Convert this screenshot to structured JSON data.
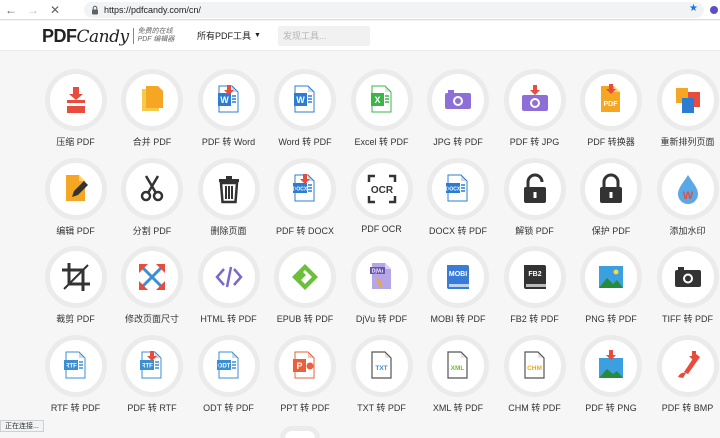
{
  "browser": {
    "url": "https://pdfcandy.com/cn/",
    "status_text": "正在连接..."
  },
  "header": {
    "logo_main": "PDF",
    "logo_script": "Candy",
    "logo_tag_line1": "免费的在线",
    "logo_tag_line2": "PDF 编辑器",
    "menu_label": "所有PDF工具",
    "search_placeholder": "发现工具..."
  },
  "tools": [
    {
      "label": "压缩 PDF",
      "icon": "compress-icon"
    },
    {
      "label": "合并 PDF",
      "icon": "merge-icon"
    },
    {
      "label": "PDF 转 Word",
      "icon": "pdf-to-word-icon"
    },
    {
      "label": "Word 转 PDF",
      "icon": "word-to-pdf-icon"
    },
    {
      "label": "Excel 转 PDF",
      "icon": "excel-to-pdf-icon"
    },
    {
      "label": "JPG 转 PDF",
      "icon": "jpg-to-pdf-icon"
    },
    {
      "label": "PDF 转 JPG",
      "icon": "pdf-to-jpg-icon"
    },
    {
      "label": "PDF 转换器",
      "icon": "pdf-converter-icon"
    },
    {
      "label": "重新排列页面",
      "icon": "rearrange-icon"
    },
    {
      "label": "编辑 PDF",
      "icon": "edit-pdf-icon"
    },
    {
      "label": "分割 PDF",
      "icon": "scissors-icon"
    },
    {
      "label": "删除页面",
      "icon": "trash-icon"
    },
    {
      "label": "PDF 转 DOCX",
      "icon": "pdf-to-docx-icon"
    },
    {
      "label": "PDF OCR",
      "icon": "ocr-icon"
    },
    {
      "label": "DOCX 转 PDF",
      "icon": "docx-to-pdf-icon"
    },
    {
      "label": "解锁 PDF",
      "icon": "unlock-icon"
    },
    {
      "label": "保护 PDF",
      "icon": "lock-icon"
    },
    {
      "label": "添加水印",
      "icon": "watermark-icon"
    },
    {
      "label": "裁剪 PDF",
      "icon": "crop-icon"
    },
    {
      "label": "修改页面尺寸",
      "icon": "resize-icon"
    },
    {
      "label": "HTML 转 PDF",
      "icon": "html-icon"
    },
    {
      "label": "EPUB 转 PDF",
      "icon": "epub-icon"
    },
    {
      "label": "DjVu 转 PDF",
      "icon": "djvu-icon"
    },
    {
      "label": "MOBI 转 PDF",
      "icon": "mobi-icon"
    },
    {
      "label": "FB2 转 PDF",
      "icon": "fb2-icon"
    },
    {
      "label": "PNG 转 PDF",
      "icon": "png-icon"
    },
    {
      "label": "TIFF 转 PDF",
      "icon": "tiff-icon"
    },
    {
      "label": "RTF 转 PDF",
      "icon": "rtf-to-pdf-icon"
    },
    {
      "label": "PDF 转 RTF",
      "icon": "pdf-to-rtf-icon"
    },
    {
      "label": "ODT 转 PDF",
      "icon": "odt-icon"
    },
    {
      "label": "PPT 转 PDF",
      "icon": "ppt-icon"
    },
    {
      "label": "TXT 转 PDF",
      "icon": "txt-icon"
    },
    {
      "label": "XML 转 PDF",
      "icon": "xml-icon"
    },
    {
      "label": "CHM 转 PDF",
      "icon": "chm-icon"
    },
    {
      "label": "PDF 转 PNG",
      "icon": "pdf-to-png-icon"
    },
    {
      "label": "PDF 转 BMP",
      "icon": "pdf-to-bmp-icon"
    }
  ],
  "colors": {
    "red": "#e74c3c",
    "orange": "#f5a623",
    "word_blue": "#2b7cd3",
    "excel_green": "#3bb54a",
    "purple": "#8e6fd8",
    "dark": "#333333",
    "html_purple": "#7b68c8",
    "epub_green": "#6cbf3b",
    "mobi_blue": "#3a7bd5"
  }
}
